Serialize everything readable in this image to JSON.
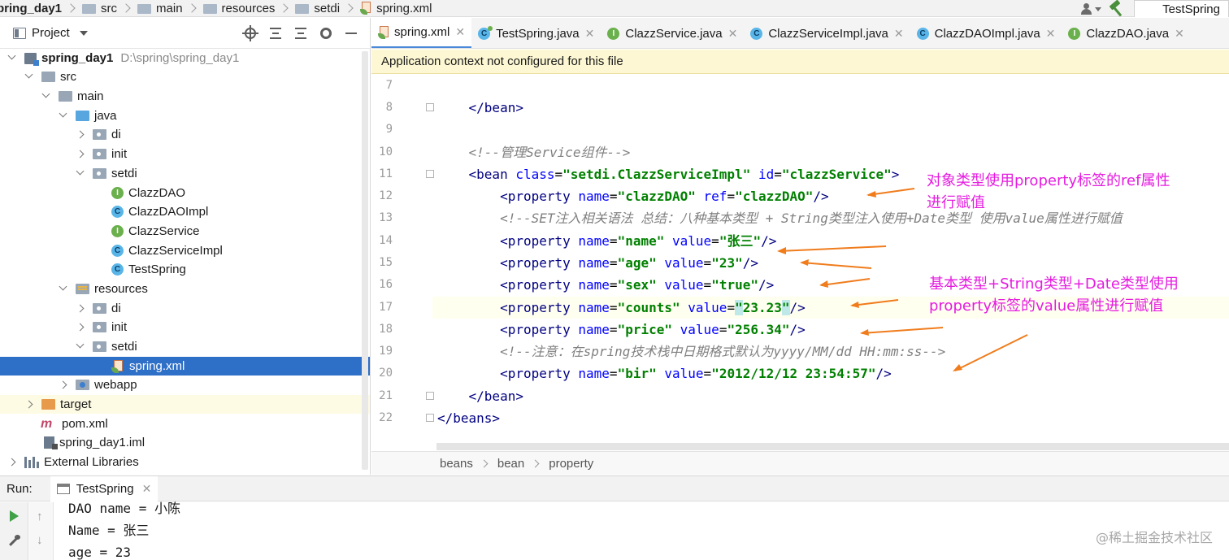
{
  "topbar": {
    "crumbs": [
      "pring_day1",
      "src",
      "main",
      "resources",
      "setdi",
      "spring.xml"
    ],
    "run_config": "TestSpring"
  },
  "project": {
    "title": "Project",
    "tree": [
      {
        "label": "spring_day1",
        "extra": "D:\\spring\\spring_day1",
        "icon": "module-icon"
      },
      {
        "label": "src",
        "icon": "folder-icon"
      },
      {
        "label": "main",
        "icon": "folder-icon"
      },
      {
        "label": "java",
        "icon": "source-folder-icon"
      },
      {
        "label": "di",
        "icon": "package-icon"
      },
      {
        "label": "init",
        "icon": "package-icon"
      },
      {
        "label": "setdi",
        "icon": "package-icon"
      },
      {
        "label": "ClazzDAO",
        "icon": "interface-icon"
      },
      {
        "label": "ClazzDAOImpl",
        "icon": "class-icon"
      },
      {
        "label": "ClazzService",
        "icon": "interface-icon"
      },
      {
        "label": "ClazzServiceImpl",
        "icon": "class-icon"
      },
      {
        "label": "TestSpring",
        "icon": "class-icon"
      },
      {
        "label": "resources",
        "icon": "resources-folder-icon"
      },
      {
        "label": "di",
        "icon": "package-icon"
      },
      {
        "label": "init",
        "icon": "package-icon"
      },
      {
        "label": "setdi",
        "icon": "package-icon"
      },
      {
        "label": "spring.xml",
        "icon": "xml-file-icon"
      },
      {
        "label": "webapp",
        "icon": "webapp-folder-icon"
      },
      {
        "label": "target",
        "icon": "excluded-folder-icon"
      },
      {
        "label": "pom.xml",
        "icon": "maven-icon"
      },
      {
        "label": "spring_day1.iml",
        "icon": "iml-file-icon"
      },
      {
        "label": "External Libraries",
        "icon": "libraries-icon"
      }
    ]
  },
  "tabs": [
    {
      "label": "spring.xml",
      "icon": "xml-file-icon",
      "active": true
    },
    {
      "label": "TestSpring.java",
      "icon": "class-icon"
    },
    {
      "label": "ClazzService.java",
      "icon": "interface-icon"
    },
    {
      "label": "ClazzServiceImpl.java",
      "icon": "class-icon"
    },
    {
      "label": "ClazzDAOImpl.java",
      "icon": "class-icon"
    },
    {
      "label": "ClazzDAO.java",
      "icon": "interface-icon"
    }
  ],
  "banner": "Application context not configured for this file",
  "editor": {
    "line_numbers": [
      "7",
      "8",
      "9",
      "10",
      "11",
      "12",
      "13",
      "14",
      "15",
      "16",
      "17",
      "18",
      "19",
      "20",
      "21",
      "22"
    ],
    "lines": {
      "l8": "    </bean>",
      "l10": "    <!--管理Service组件-->",
      "l11_a": "    <bean ",
      "l11_attr1": "class",
      "l11_val1": "\"setdi.ClazzServiceImpl\"",
      "l11_attr2": "id",
      "l11_val2": "\"clazzService\"",
      "l12_attr1": "name",
      "l12_val1": "\"clazzDAO\"",
      "l12_attr2": "ref",
      "l12_val2": "\"clazzDAO\"",
      "l13": "        <!--SET注入相关语法 总结：八种基本类型 + String类型注入使用+Date类型 使用value属性进行赋值",
      "l14_val1": "\"name\"",
      "l14_val2": "\"张三\"",
      "l15_val1": "\"age\"",
      "l15_val2": "\"23\"",
      "l16_val1": "\"sex\"",
      "l16_val2": "\"true\"",
      "l17_val1": "\"counts\"",
      "l17_val2a": "\"",
      "l17_val2b": "23.23",
      "l17_val2c": "\"",
      "l18_val1": "\"price\"",
      "l18_val2": "\"256.34\"",
      "l19": "        <!--注意：在spring技术栈中日期格式默认为yyyy/MM/dd HH:mm:ss-->",
      "l20_val1": "\"bir\"",
      "l20_val2": "\"2012/12/12 23:54:57\"",
      "l21": "    </bean>",
      "l22": "</beans>"
    },
    "tokens": {
      "property_open": "<property ",
      "name_attr": "name",
      "value_attr": "value",
      "eq": "=",
      "close": "/>",
      "gt": ">"
    }
  },
  "annotations": {
    "note1_line1": "对象类型使用property标签的ref属性",
    "note1_line2": "进行赋值",
    "note2_line1": "基本类型+String类型+Date类型使用",
    "note2_line2": "property标签的value属性进行赋值",
    "color": "#e51ce0",
    "arrow_color": "#f07c1c"
  },
  "code_crumbs": [
    "beans",
    "bean",
    "property"
  ],
  "run": {
    "label": "Run:",
    "tab": "TestSpring",
    "output": [
      "DAO name = 小陈",
      "Name = 张三",
      "age = 23"
    ]
  },
  "watermark": "@稀土掘金技术社区"
}
